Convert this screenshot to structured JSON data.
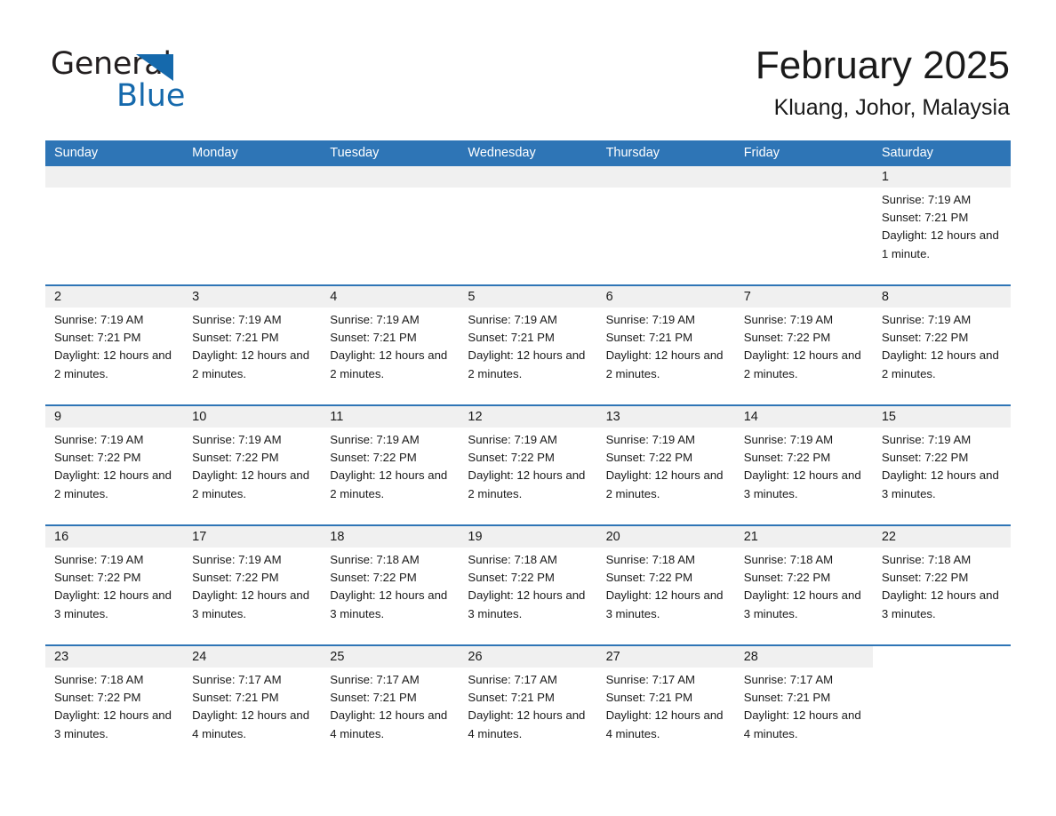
{
  "brand": {
    "name_part1": "General",
    "name_part2": "Blue",
    "logo_icon": "triangle-icon",
    "accent_color": "#1569ac"
  },
  "header": {
    "month_title": "February 2025",
    "location": "Kluang, Johor, Malaysia"
  },
  "theme": {
    "header_blue": "#2e75b6",
    "day_band_gray": "#f0f0f0",
    "text_color": "#1a1a1a"
  },
  "calendar": {
    "weekdays": [
      "Sunday",
      "Monday",
      "Tuesday",
      "Wednesday",
      "Thursday",
      "Friday",
      "Saturday"
    ],
    "weeks": [
      [
        {
          "day": "",
          "empty": true
        },
        {
          "day": "",
          "empty": true
        },
        {
          "day": "",
          "empty": true
        },
        {
          "day": "",
          "empty": true
        },
        {
          "day": "",
          "empty": true
        },
        {
          "day": "",
          "empty": true
        },
        {
          "day": "1",
          "sunrise": "Sunrise: 7:19 AM",
          "sunset": "Sunset: 7:21 PM",
          "daylight": "Daylight: 12 hours and 1 minute."
        }
      ],
      [
        {
          "day": "2",
          "sunrise": "Sunrise: 7:19 AM",
          "sunset": "Sunset: 7:21 PM",
          "daylight": "Daylight: 12 hours and 2 minutes."
        },
        {
          "day": "3",
          "sunrise": "Sunrise: 7:19 AM",
          "sunset": "Sunset: 7:21 PM",
          "daylight": "Daylight: 12 hours and 2 minutes."
        },
        {
          "day": "4",
          "sunrise": "Sunrise: 7:19 AM",
          "sunset": "Sunset: 7:21 PM",
          "daylight": "Daylight: 12 hours and 2 minutes."
        },
        {
          "day": "5",
          "sunrise": "Sunrise: 7:19 AM",
          "sunset": "Sunset: 7:21 PM",
          "daylight": "Daylight: 12 hours and 2 minutes."
        },
        {
          "day": "6",
          "sunrise": "Sunrise: 7:19 AM",
          "sunset": "Sunset: 7:21 PM",
          "daylight": "Daylight: 12 hours and 2 minutes."
        },
        {
          "day": "7",
          "sunrise": "Sunrise: 7:19 AM",
          "sunset": "Sunset: 7:22 PM",
          "daylight": "Daylight: 12 hours and 2 minutes."
        },
        {
          "day": "8",
          "sunrise": "Sunrise: 7:19 AM",
          "sunset": "Sunset: 7:22 PM",
          "daylight": "Daylight: 12 hours and 2 minutes."
        }
      ],
      [
        {
          "day": "9",
          "sunrise": "Sunrise: 7:19 AM",
          "sunset": "Sunset: 7:22 PM",
          "daylight": "Daylight: 12 hours and 2 minutes."
        },
        {
          "day": "10",
          "sunrise": "Sunrise: 7:19 AM",
          "sunset": "Sunset: 7:22 PM",
          "daylight": "Daylight: 12 hours and 2 minutes."
        },
        {
          "day": "11",
          "sunrise": "Sunrise: 7:19 AM",
          "sunset": "Sunset: 7:22 PM",
          "daylight": "Daylight: 12 hours and 2 minutes."
        },
        {
          "day": "12",
          "sunrise": "Sunrise: 7:19 AM",
          "sunset": "Sunset: 7:22 PM",
          "daylight": "Daylight: 12 hours and 2 minutes."
        },
        {
          "day": "13",
          "sunrise": "Sunrise: 7:19 AM",
          "sunset": "Sunset: 7:22 PM",
          "daylight": "Daylight: 12 hours and 2 minutes."
        },
        {
          "day": "14",
          "sunrise": "Sunrise: 7:19 AM",
          "sunset": "Sunset: 7:22 PM",
          "daylight": "Daylight: 12 hours and 3 minutes."
        },
        {
          "day": "15",
          "sunrise": "Sunrise: 7:19 AM",
          "sunset": "Sunset: 7:22 PM",
          "daylight": "Daylight: 12 hours and 3 minutes."
        }
      ],
      [
        {
          "day": "16",
          "sunrise": "Sunrise: 7:19 AM",
          "sunset": "Sunset: 7:22 PM",
          "daylight": "Daylight: 12 hours and 3 minutes."
        },
        {
          "day": "17",
          "sunrise": "Sunrise: 7:19 AM",
          "sunset": "Sunset: 7:22 PM",
          "daylight": "Daylight: 12 hours and 3 minutes."
        },
        {
          "day": "18",
          "sunrise": "Sunrise: 7:18 AM",
          "sunset": "Sunset: 7:22 PM",
          "daylight": "Daylight: 12 hours and 3 minutes."
        },
        {
          "day": "19",
          "sunrise": "Sunrise: 7:18 AM",
          "sunset": "Sunset: 7:22 PM",
          "daylight": "Daylight: 12 hours and 3 minutes."
        },
        {
          "day": "20",
          "sunrise": "Sunrise: 7:18 AM",
          "sunset": "Sunset: 7:22 PM",
          "daylight": "Daylight: 12 hours and 3 minutes."
        },
        {
          "day": "21",
          "sunrise": "Sunrise: 7:18 AM",
          "sunset": "Sunset: 7:22 PM",
          "daylight": "Daylight: 12 hours and 3 minutes."
        },
        {
          "day": "22",
          "sunrise": "Sunrise: 7:18 AM",
          "sunset": "Sunset: 7:22 PM",
          "daylight": "Daylight: 12 hours and 3 minutes."
        }
      ],
      [
        {
          "day": "23",
          "sunrise": "Sunrise: 7:18 AM",
          "sunset": "Sunset: 7:22 PM",
          "daylight": "Daylight: 12 hours and 3 minutes."
        },
        {
          "day": "24",
          "sunrise": "Sunrise: 7:17 AM",
          "sunset": "Sunset: 7:21 PM",
          "daylight": "Daylight: 12 hours and 4 minutes."
        },
        {
          "day": "25",
          "sunrise": "Sunrise: 7:17 AM",
          "sunset": "Sunset: 7:21 PM",
          "daylight": "Daylight: 12 hours and 4 minutes."
        },
        {
          "day": "26",
          "sunrise": "Sunrise: 7:17 AM",
          "sunset": "Sunset: 7:21 PM",
          "daylight": "Daylight: 12 hours and 4 minutes."
        },
        {
          "day": "27",
          "sunrise": "Sunrise: 7:17 AM",
          "sunset": "Sunset: 7:21 PM",
          "daylight": "Daylight: 12 hours and 4 minutes."
        },
        {
          "day": "28",
          "sunrise": "Sunrise: 7:17 AM",
          "sunset": "Sunset: 7:21 PM",
          "daylight": "Daylight: 12 hours and 4 minutes."
        },
        {
          "day": "",
          "empty": true,
          "no_band": true
        }
      ]
    ]
  }
}
